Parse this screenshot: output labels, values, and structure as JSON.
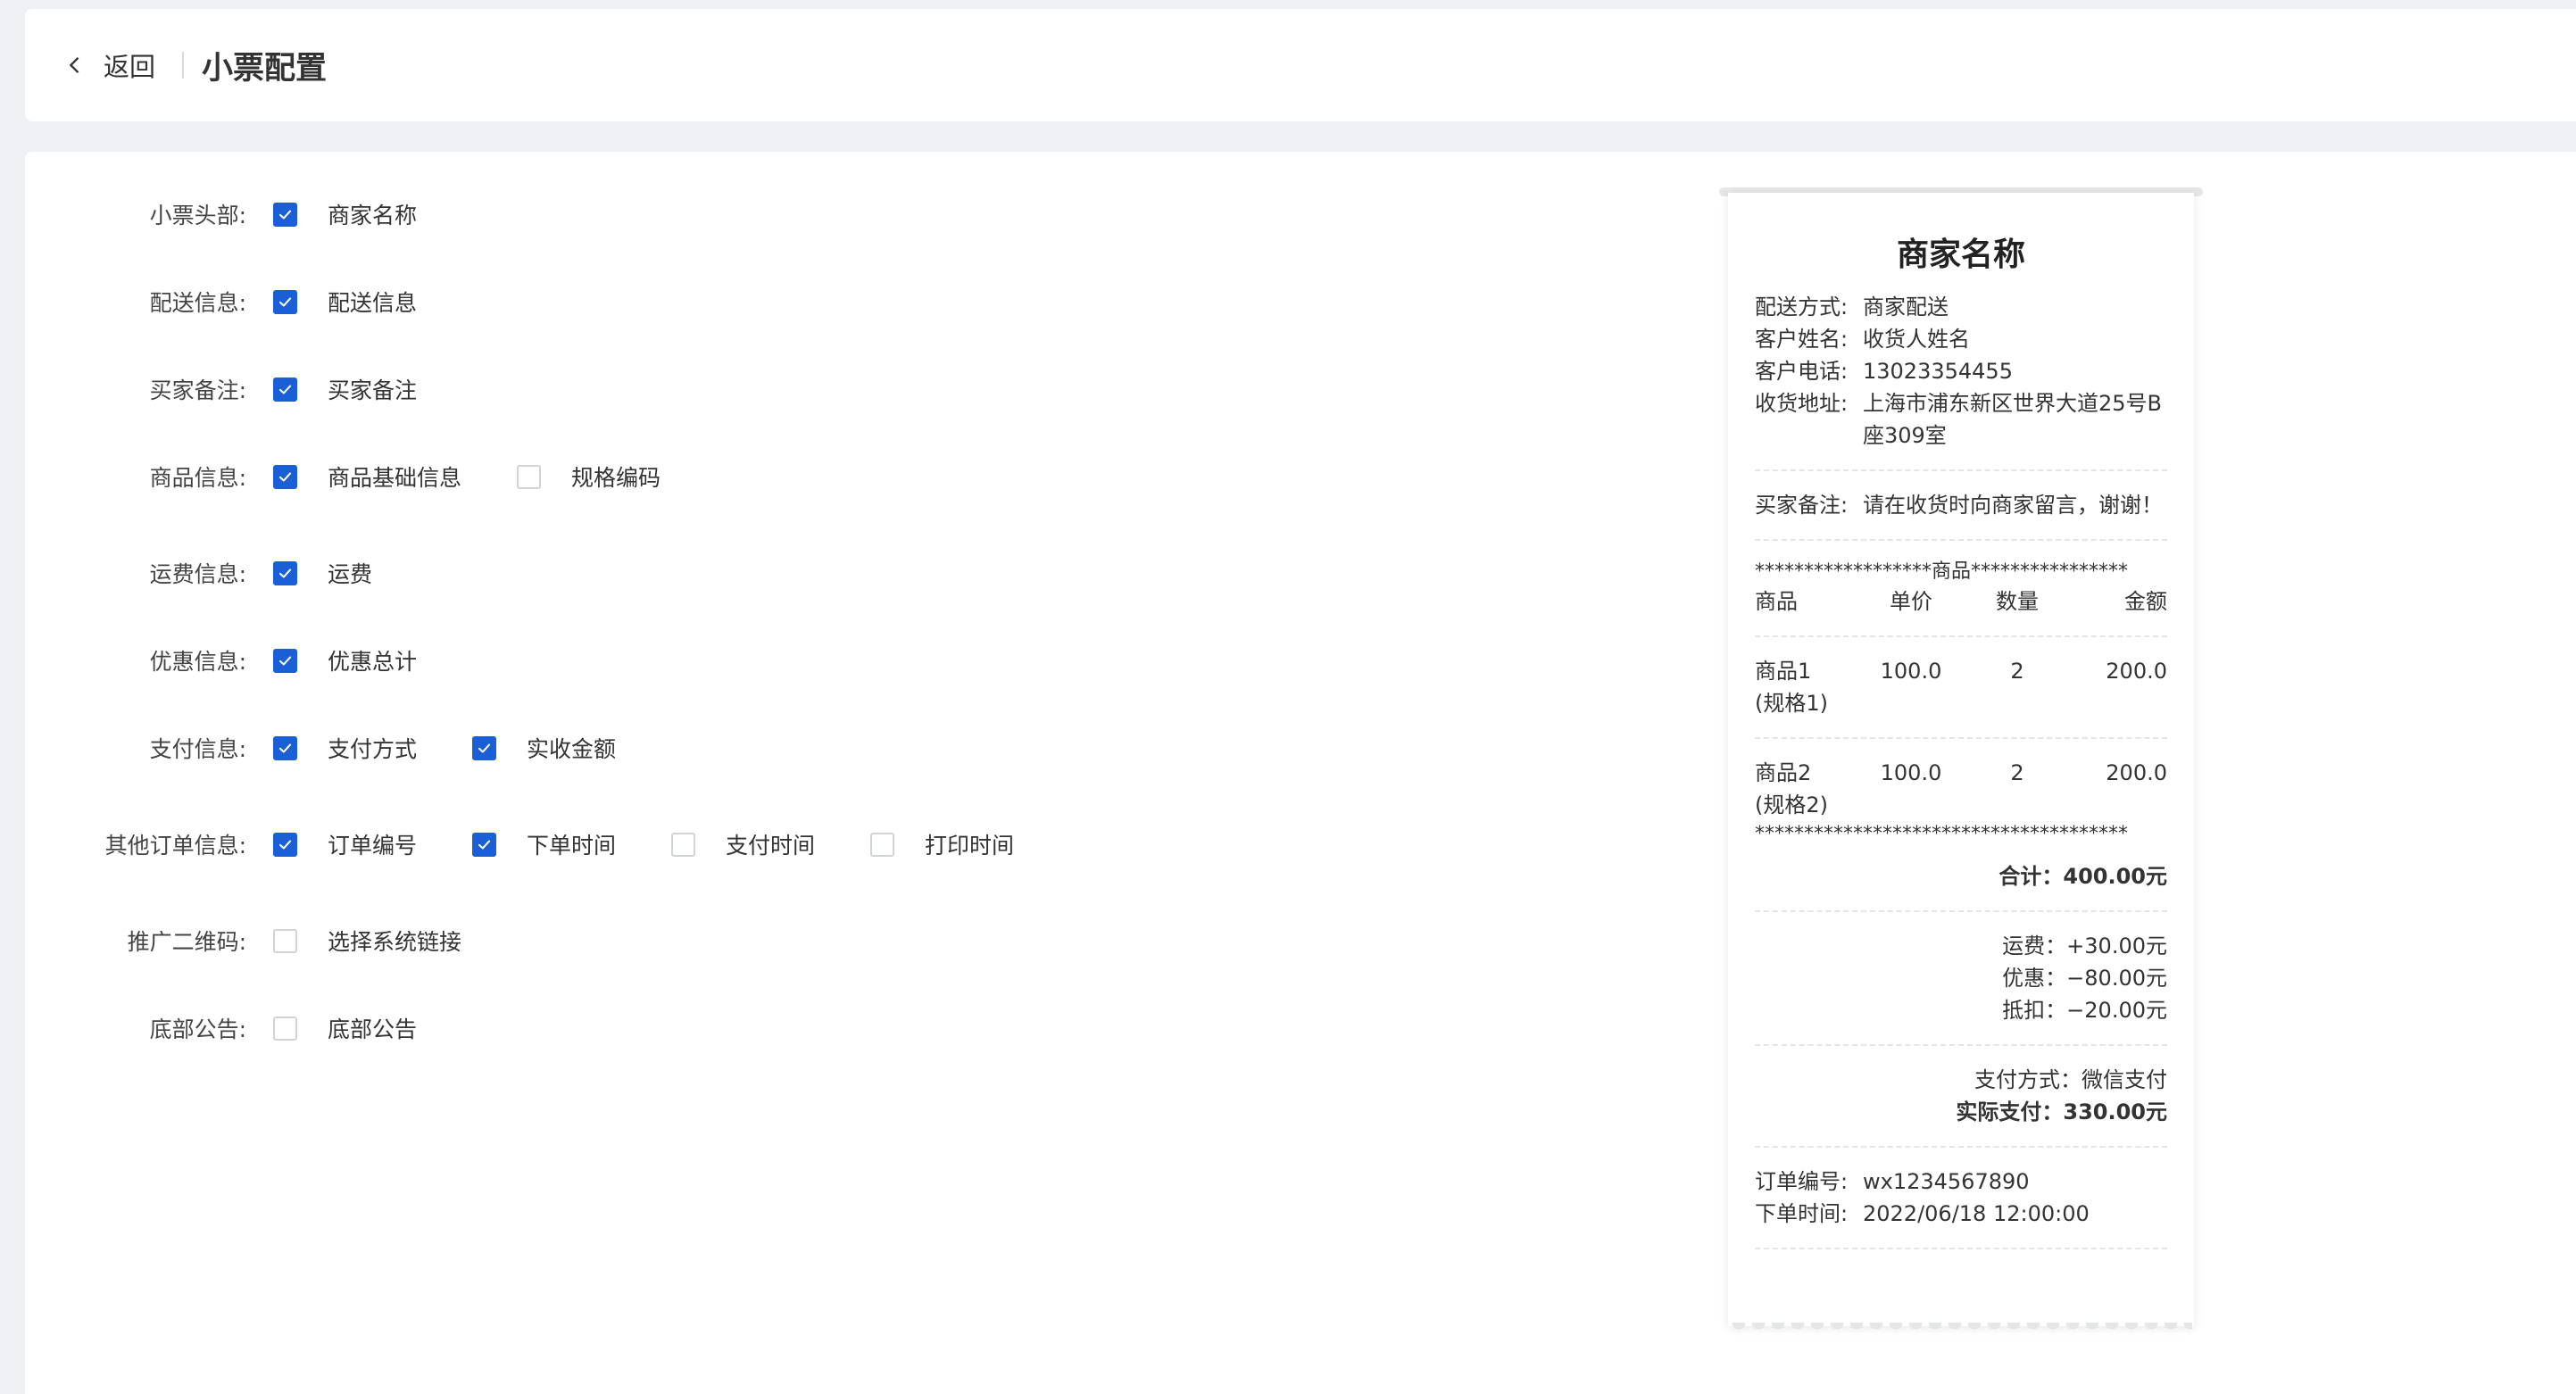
{
  "header": {
    "back_label": "返回",
    "title": "小票配置"
  },
  "config": {
    "rows": [
      {
        "label": "小票头部:",
        "options": [
          {
            "label": "商家名称",
            "checked": true
          }
        ]
      },
      {
        "label": "配送信息:",
        "options": [
          {
            "label": "配送信息",
            "checked": true
          }
        ]
      },
      {
        "label": "买家备注:",
        "options": [
          {
            "label": "买家备注",
            "checked": true
          }
        ]
      },
      {
        "label": "商品信息:",
        "options": [
          {
            "label": "商品基础信息",
            "checked": true
          },
          {
            "label": "规格编码",
            "checked": false
          }
        ]
      },
      {
        "label": "运费信息:",
        "options": [
          {
            "label": "运费",
            "checked": true
          }
        ]
      },
      {
        "label": "优惠信息:",
        "options": [
          {
            "label": "优惠总计",
            "checked": true
          }
        ]
      },
      {
        "label": "支付信息:",
        "options": [
          {
            "label": "支付方式",
            "checked": true
          },
          {
            "label": "实收金额",
            "checked": true
          }
        ]
      },
      {
        "label": "其他订单信息:",
        "options": [
          {
            "label": "订单编号",
            "checked": true
          },
          {
            "label": "下单时间",
            "checked": true
          },
          {
            "label": "支付时间",
            "checked": false
          },
          {
            "label": "打印时间",
            "checked": false
          }
        ]
      },
      {
        "label": "推广二维码:",
        "options": [
          {
            "label": "选择系统链接",
            "checked": false
          }
        ]
      },
      {
        "label": "底部公告:",
        "options": [
          {
            "label": "底部公告",
            "checked": false
          }
        ]
      }
    ]
  },
  "receipt": {
    "title": "商家名称",
    "delivery": {
      "method_k": "配送方式:",
      "method_v": "商家配送",
      "name_k": "客户姓名:",
      "name_v": "收货人姓名",
      "phone_k": "客户电话:",
      "phone_v": "13023354455",
      "addr_k": "收货地址:",
      "addr_v": "上海市浦东新区世界大道25号B座309室"
    },
    "note": {
      "k": "买家备注:",
      "v": "请在收货时向商家留言，谢谢！"
    },
    "goods_banner": "******************商品****************",
    "goods_header": {
      "c1": "商品",
      "c2": "单价",
      "c3": "数量",
      "c4": "金额"
    },
    "goods": [
      {
        "name": "商品1",
        "spec": "(规格1)",
        "price": "100.0",
        "qty": "2",
        "amount": "200.0"
      },
      {
        "name": "商品2",
        "spec": "(规格2)",
        "price": "100.0",
        "qty": "2",
        "amount": "200.0"
      }
    ],
    "stars_end": "**************************************",
    "total": "合计：400.00元",
    "fee": "运费：+30.00元",
    "discount": "优惠：−80.00元",
    "deduct": "抵扣：−20.00元",
    "pay_method": "支付方式：微信支付",
    "paid": "实际支付：330.00元",
    "order_no_k": "订单编号:",
    "order_no_v": "wx1234567890",
    "order_time_k": "下单时间:",
    "order_time_v": "2022/06/18 12:00:00"
  },
  "colors": {
    "accent": "#1a5ed8",
    "background": "#eef0f3"
  },
  "icons": {
    "back": "chevron-left-icon",
    "check": "check-icon"
  }
}
